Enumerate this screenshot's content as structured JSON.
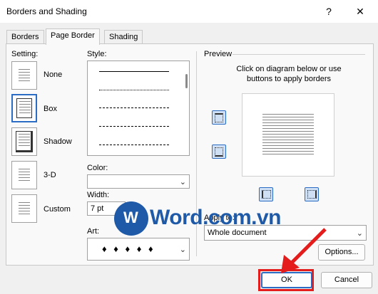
{
  "window": {
    "title": "Borders and Shading",
    "help_glyph": "?",
    "close_glyph": "✕"
  },
  "tabs": [
    {
      "label": "Borders",
      "mnemonic": "B"
    },
    {
      "label": "Page Border",
      "mnemonic": "P",
      "active": true
    },
    {
      "label": "Shading",
      "mnemonic": "S"
    }
  ],
  "setting": {
    "label": "Setting:",
    "options": [
      {
        "label": "None"
      },
      {
        "label": "Box",
        "selected": true
      },
      {
        "label": "Shadow"
      },
      {
        "label": "3-D"
      },
      {
        "label": "Custom"
      }
    ]
  },
  "style": {
    "label": "Style:",
    "items": [
      "solid",
      "dotted",
      "dashed-small",
      "dashed",
      "dash-dot"
    ]
  },
  "color": {
    "label": "Color:",
    "value": ""
  },
  "width": {
    "label": "Width:",
    "value": "7 pt"
  },
  "art": {
    "label": "Art:",
    "value": "♦ ♦ ♦ ♦ ♦"
  },
  "preview": {
    "label": "Preview",
    "hint": "Click on diagram below or use buttons to apply borders"
  },
  "apply_to": {
    "label": "Apply to:",
    "value": "Whole document"
  },
  "buttons": {
    "options": "Options...",
    "ok": "OK",
    "cancel": "Cancel"
  },
  "watermark": {
    "text": "Word.com.vn",
    "logo_letter": "W"
  },
  "colors": {
    "accent": "#2b6cc4",
    "highlight": "#e41c1c",
    "watermark": "#1f5aa8"
  }
}
